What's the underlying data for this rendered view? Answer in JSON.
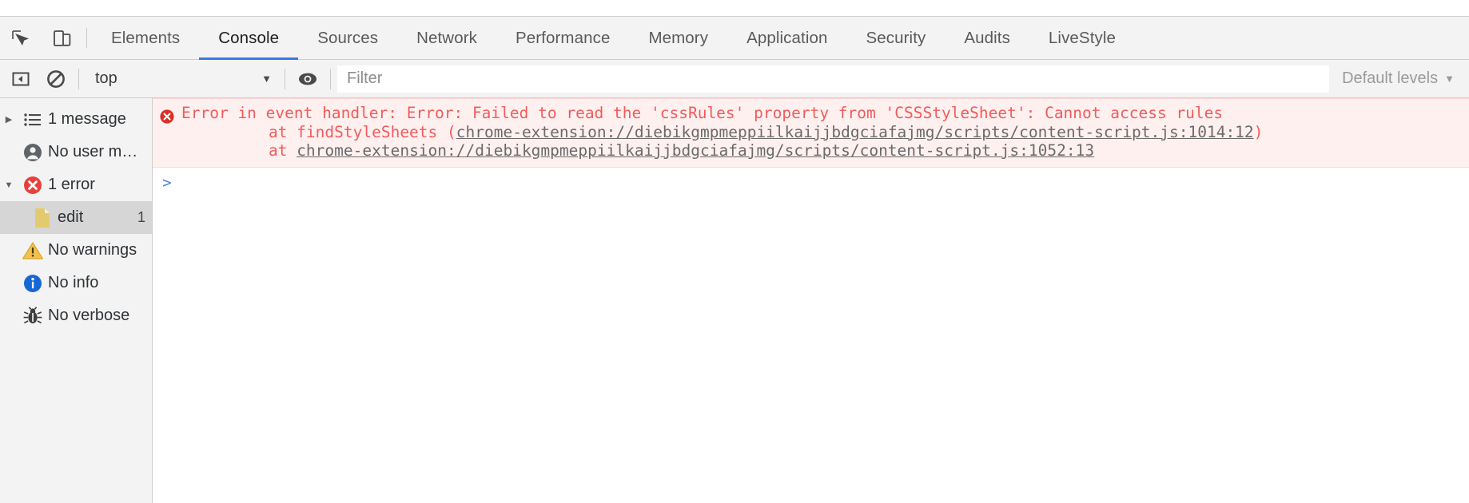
{
  "toolbar_icons": {
    "inspect": "inspect-cursor-icon",
    "device": "device-toolbar-icon"
  },
  "tabs": [
    {
      "label": "Elements",
      "active": false
    },
    {
      "label": "Console",
      "active": true
    },
    {
      "label": "Sources",
      "active": false
    },
    {
      "label": "Network",
      "active": false
    },
    {
      "label": "Performance",
      "active": false
    },
    {
      "label": "Memory",
      "active": false
    },
    {
      "label": "Application",
      "active": false
    },
    {
      "label": "Security",
      "active": false
    },
    {
      "label": "Audits",
      "active": false
    },
    {
      "label": "LiveStyle",
      "active": false
    }
  ],
  "console_toolbar": {
    "sidebar_toggle_icon": "sidebar-toggle-icon",
    "clear_icon": "clear-console-icon",
    "context_value": "top",
    "context_caret": "▼",
    "eye_icon": "eye-icon",
    "filter_placeholder": "Filter",
    "filter_value": "",
    "levels_label": "Default levels",
    "levels_caret": "▼"
  },
  "sidebar": {
    "items": [
      {
        "label": "1 message",
        "icon": "list-icon",
        "triangle": "▶",
        "count": "",
        "selected": false,
        "child": false
      },
      {
        "label": "No user me…",
        "icon": "person-icon",
        "triangle": "",
        "count": "",
        "selected": false,
        "child": false
      },
      {
        "label": "1 error",
        "icon": "error-icon",
        "triangle": "▼",
        "count": "",
        "selected": false,
        "child": false
      },
      {
        "label": "edit",
        "icon": "document-icon",
        "triangle": "",
        "count": "1",
        "selected": true,
        "child": true
      },
      {
        "label": "No warnings",
        "icon": "warning-icon",
        "triangle": "",
        "count": "",
        "selected": false,
        "child": false
      },
      {
        "label": "No info",
        "icon": "info-icon",
        "triangle": "",
        "count": "",
        "selected": false,
        "child": false
      },
      {
        "label": "No verbose",
        "icon": "verbose-bug-icon",
        "triangle": "",
        "count": "",
        "selected": false,
        "child": false
      }
    ]
  },
  "console_output": {
    "error": {
      "icon": "error-icon",
      "line1": "Error in event handler: Error: Failed to read the 'cssRules' property from 'CSSStyleSheet': Cannot access rules",
      "line2_prefix": "    at findStyleSheets (",
      "line2_link": "chrome-extension://diebikgmpmeppiilkaijjbdgciafajmg/scripts/content-script.js:1014:12",
      "line2_suffix": ")",
      "line3_prefix": "    at ",
      "line3_link": "chrome-extension://diebikgmpmeppiilkaijjbdgciafajmg/scripts/content-script.js:1052:13",
      "line3_suffix": ""
    },
    "prompt_symbol": ">",
    "prompt_value": ""
  },
  "colors": {
    "accent_blue": "#3b78e7",
    "error_red": "#f15b5b",
    "error_bg": "#fff0f0",
    "toolbar_bg": "#f3f3f3",
    "selected_row": "#d6d6d6",
    "link_gray": "#6a6a6a"
  }
}
